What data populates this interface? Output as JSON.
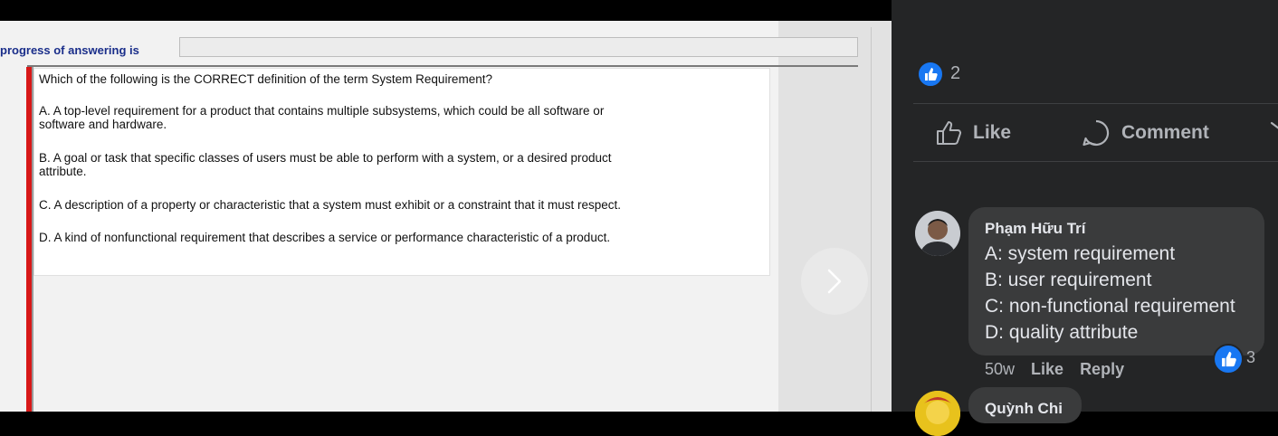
{
  "quiz": {
    "progress_label": "progress of answering is",
    "question": "Which of the following is the CORRECT definition of the term System Requirement?",
    "options": [
      {
        "line1": "A.  A top-level requirement for a product that contains multiple subsystems, which could be all software or",
        "line2": "software and hardware."
      },
      {
        "line1": "B.  A goal or task that specific classes of users must be able to perform with a system, or a desired product",
        "line2": "attribute."
      },
      {
        "line1": "C.  A description of a property or characteristic that a system must exhibit or a constraint that it must respect.",
        "line2": ""
      },
      {
        "line1": "D.  A kind of nonfunctional requirement that describes a service or performance characteristic of a product.",
        "line2": ""
      }
    ]
  },
  "post": {
    "reaction_count": "2",
    "reaction_icon": "like-icon",
    "actions": {
      "like": "Like",
      "comment": "Comment"
    },
    "accent_color": "#1877f2"
  },
  "comments": [
    {
      "author": "Phạm Hữu Trí",
      "lines": [
        "A: system requirement",
        "B: user requirement",
        "C: non-functional requirement",
        "D: quality attribute"
      ],
      "age": "50w",
      "like_label": "Like",
      "reply_label": "Reply",
      "reaction_count": "3"
    },
    {
      "author": "Quỳnh Chi"
    }
  ]
}
